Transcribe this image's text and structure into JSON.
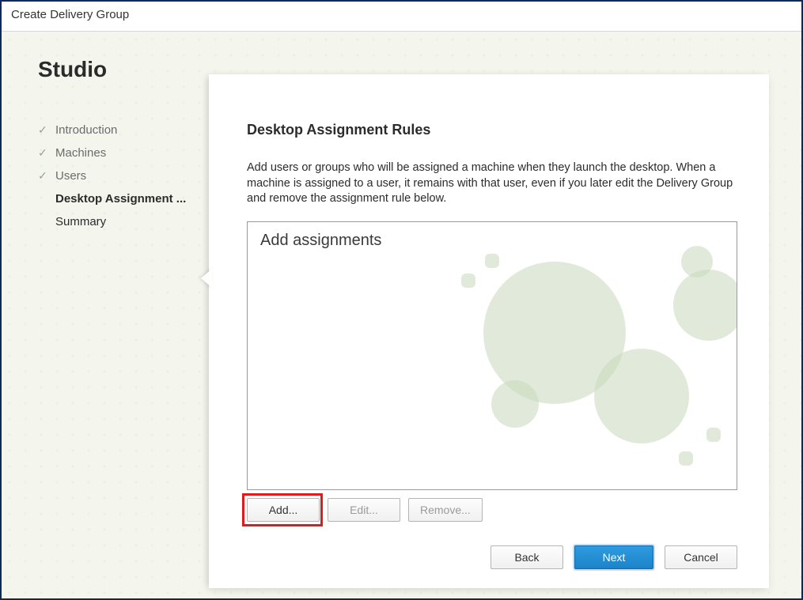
{
  "window_title": "Create Delivery Group",
  "sidebar": {
    "app_title": "Studio",
    "steps": [
      {
        "label": "Introduction",
        "state": "done"
      },
      {
        "label": "Machines",
        "state": "done"
      },
      {
        "label": "Users",
        "state": "done"
      },
      {
        "label": "Desktop Assignment ...",
        "state": "active"
      },
      {
        "label": "Summary",
        "state": "pending"
      }
    ]
  },
  "panel": {
    "heading": "Desktop Assignment Rules",
    "description": "Add users or groups who will be assigned a machine when they launch the desktop. When a machine is assigned to a user, it remains with that user, even if you later edit the Delivery Group and remove the assignment rule below.",
    "list_title": "Add assignments"
  },
  "buttons": {
    "add": "Add...",
    "edit": "Edit...",
    "remove": "Remove...",
    "back": "Back",
    "next": "Next",
    "cancel": "Cancel"
  }
}
